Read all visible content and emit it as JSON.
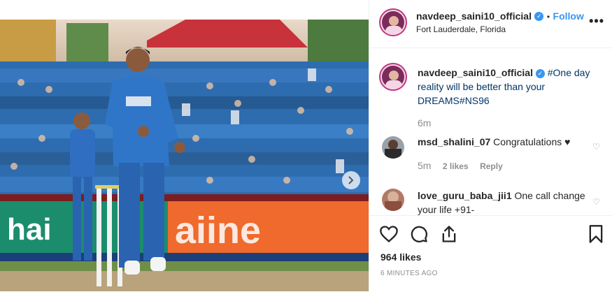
{
  "post": {
    "image_alt": "Cricketer in blue kit celebrating on the field in front of a stadium crowd",
    "next_icon": "chevron-right-icon"
  },
  "header": {
    "username": "navdeep_saini10_official",
    "follow_label": "Follow",
    "separator": "•",
    "location": "Fort Lauderdale, Florida",
    "more_label": "•••"
  },
  "caption": {
    "username": "navdeep_saini10_official",
    "text_part1": "#One day reality will be better than your DREAMS",
    "hashtag": "#NS96",
    "time": "6m"
  },
  "comments": [
    {
      "username": "msd_shalini_07",
      "text": "Congratulations ♥",
      "time": "5m",
      "likes": "2 likes",
      "reply_label": "Reply"
    },
    {
      "username": "love_guru_baba_jii1",
      "text": "One call change your life +91-"
    }
  ],
  "actions": {
    "likes": "964 likes",
    "time_ago": "6 MINUTES AGO"
  },
  "colors": {
    "accent": "#3897f0",
    "hashtag": "#003569",
    "muted": "#8e8e8e"
  }
}
